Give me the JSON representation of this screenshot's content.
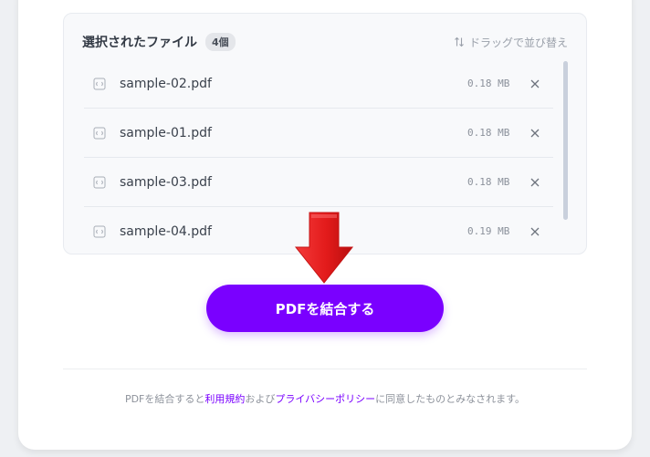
{
  "panel": {
    "title": "選択されたファイル",
    "count_badge": "4個",
    "sort_hint": "ドラッグで並び替え",
    "sort_icon": "sort-updown-icon"
  },
  "files": [
    {
      "name": "sample-02.pdf",
      "size": "0.18 MB"
    },
    {
      "name": "sample-01.pdf",
      "size": "0.18 MB"
    },
    {
      "name": "sample-03.pdf",
      "size": "0.18 MB"
    },
    {
      "name": "sample-04.pdf",
      "size": "0.19 MB"
    }
  ],
  "merge_button": {
    "label": "PDFを結合する"
  },
  "terms": {
    "prefix": "PDFを結合すると",
    "terms_link": "利用規約",
    "middle": "および",
    "privacy_link": "プライバシーポリシー",
    "suffix": "に同意したものとみなされます。"
  },
  "colors": {
    "accent": "#7a00ff",
    "arrow": "#e21a1a",
    "panel_bg": "#f8f9fb"
  }
}
